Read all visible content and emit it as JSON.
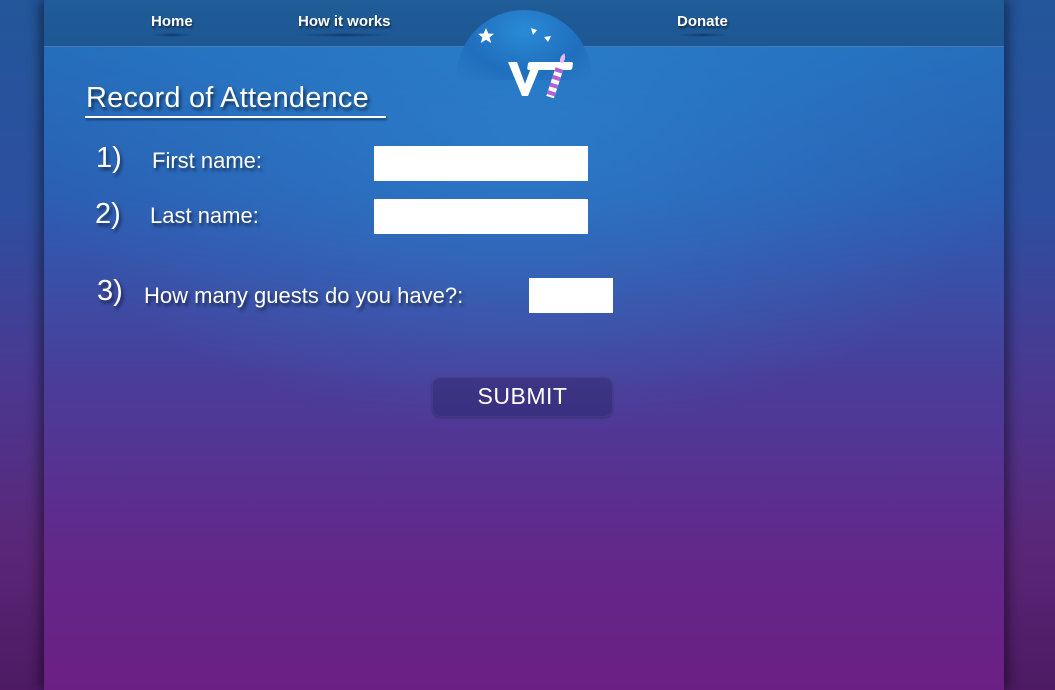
{
  "nav": {
    "home": "Home",
    "how_it_works": "How it works",
    "donate": "Donate"
  },
  "logo": {
    "text": "VT"
  },
  "form": {
    "title": "Record of Attendence",
    "fields": [
      {
        "number": "1)",
        "label": "First name:",
        "value": "",
        "placeholder": ""
      },
      {
        "number": "2)",
        "label": "Last name:",
        "value": "",
        "placeholder": ""
      },
      {
        "number": "3)",
        "label": "How many guests do you have?:",
        "value": "",
        "placeholder": ""
      }
    ],
    "submit_label": "SUBMIT"
  },
  "colors": {
    "nav_bar": "#1f5c98",
    "page_top": "#2374c0",
    "page_bottom": "#6b1f84",
    "submit_bg": "#3d3585",
    "logo_candle_stripe": "#b45fd6",
    "text": "#ffffff"
  }
}
